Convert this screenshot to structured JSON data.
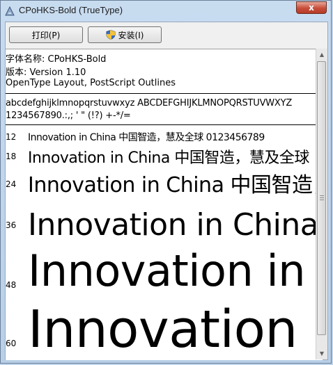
{
  "window": {
    "title": "CPoHKS-Bold (TrueType)",
    "close_label": "x"
  },
  "toolbar": {
    "print_label": "打印(P)",
    "install_label": "安装(I)"
  },
  "font_info": {
    "name_line": "字体名称: CPoHKS-Bold",
    "version_line": "版本: Version 1.10",
    "type_line": "OpenType Layout, PostScript Outlines"
  },
  "charset": {
    "line1": "abcdefghijklmnopqrstuvwxyz  ABCDEFGHIJKLMNOPQRSTUVWXYZ",
    "line2": "1234567890.:,; ' \" (!?) +-*/="
  },
  "samples": [
    {
      "size": "12",
      "text": "Innovation in China 中国智造，慧及全球 0123456789"
    },
    {
      "size": "18",
      "text": "Innovation in China 中国智造，慧及全球"
    },
    {
      "size": "24",
      "text": "Innovation in China 中国智造，慧"
    },
    {
      "size": "36",
      "text": "Innovation in China 中"
    },
    {
      "size": "48",
      "text": "Innovation in Ch"
    },
    {
      "size": "60",
      "text": "Innovation in"
    }
  ],
  "icons": {
    "app": "font-file-icon",
    "install": "uac-shield-icon"
  }
}
